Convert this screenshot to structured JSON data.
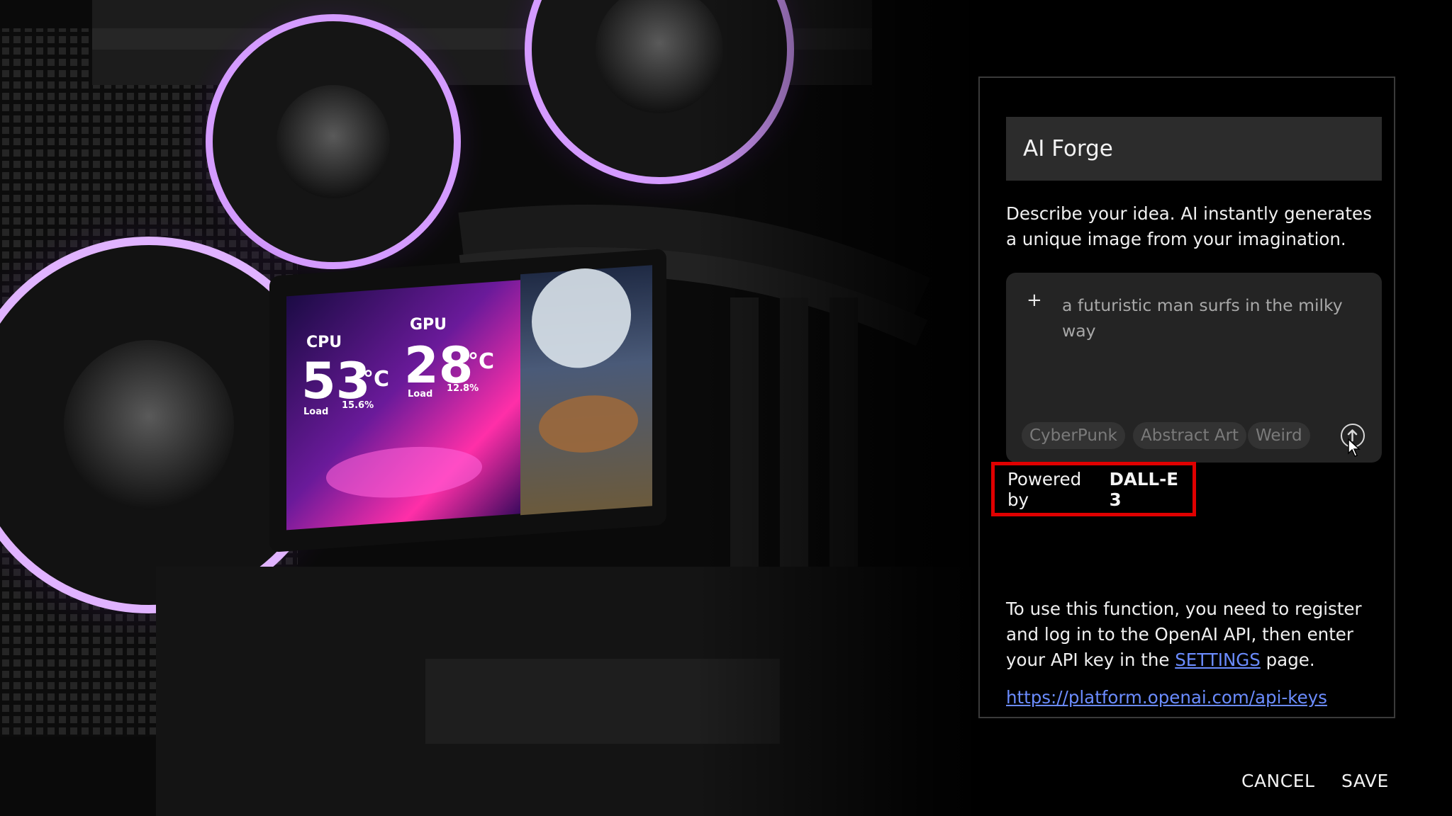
{
  "dialog": {
    "title": "AI Forge",
    "description": "Describe your idea. AI instantly generates a unique image from your imagination.",
    "prompt": {
      "add_icon": "plus-icon",
      "text": "a futuristic man surfs in the milky way",
      "send_icon": "arrow-up-circle-icon"
    },
    "chips": [
      "CyberPunk",
      "Abstract Art",
      "Weird"
    ],
    "powered_by": {
      "prefix": "Powered by",
      "model": "DALL-E 3",
      "highlight_color": "#e00000"
    },
    "info": {
      "before_link": "To use this function, you need to register and log in to the OpenAI API, then enter your API key in the ",
      "link_label": "SETTINGS",
      "after_link": " page."
    },
    "api_url": "https://platform.openai.com/api-keys",
    "cancel_label": "CANCEL",
    "save_label": "SAVE",
    "link_color": "#6b8cff"
  },
  "background": {
    "lcd": {
      "cpu_label": "CPU",
      "cpu_temp": "53",
      "cpu_unit": "°C",
      "cpu_load_label": "Load",
      "cpu_load": "15.6%",
      "gpu_label": "GPU",
      "gpu_temp": "28",
      "gpu_unit": "°C",
      "gpu_load_label": "Load",
      "gpu_load": "12.8%"
    },
    "accent_color": "#b56cff"
  }
}
